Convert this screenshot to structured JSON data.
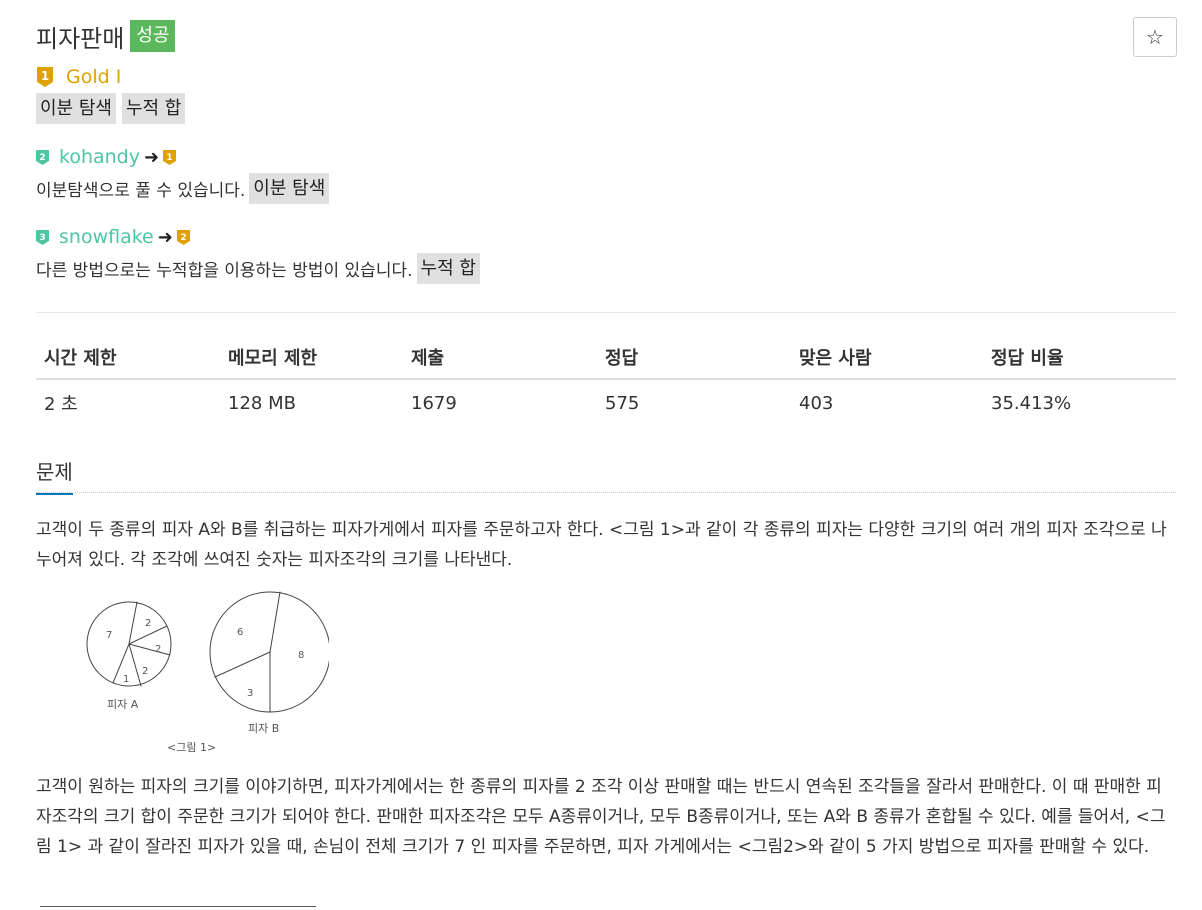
{
  "problem": {
    "title": "피자판매",
    "status": "성공",
    "star": "☆",
    "tier": {
      "label": "Gold I",
      "icon": "gold-tier-1-icon",
      "digit": "1",
      "color": "#e0a106"
    },
    "tags": [
      "이분 탐색",
      "누적 합"
    ]
  },
  "contributions": [
    {
      "user": "kohandy",
      "from_icon": "tier-2-icon",
      "from_digit": "2",
      "arrow": "➜",
      "to_icon": "tier-1-icon",
      "to_digit": "1",
      "text": "이분탐색으로 풀 수 있습니다.",
      "tag": "이분 탐색"
    },
    {
      "user": "snowflake",
      "from_icon": "tier-3-icon",
      "from_digit": "3",
      "arrow": "➜",
      "to_icon": "tier-2-icon",
      "to_digit": "2",
      "text": "다른 방법으로는 누적합을 이용하는 방법이 있습니다.",
      "tag": "누적 합"
    }
  ],
  "info_table": {
    "headers": [
      "시간 제한",
      "메모리 제한",
      "제출",
      "정답",
      "맞은 사람",
      "정답 비율"
    ],
    "values": [
      "2 초",
      "128 MB",
      "1679",
      "575",
      "403",
      "35.413%"
    ]
  },
  "section": {
    "title": "문제"
  },
  "paragraphs": {
    "p1": "고객이 두 종류의 피자 A와 B를 취급하는 피자가게에서 피자를 주문하고자 한다. <그림 1>과 같이 각 종류의 피자는 다양한 크기의 여러 개의 피자 조각으로 나누어져 있다. 각 조각에 쓰여진 숫자는 피자조각의 크기를 나타낸다.",
    "p2": "고객이 원하는 피자의 크기를 이야기하면, 피자가게에서는 한 종류의 피자를 2 조각 이상 판매할 때는 반드시 연속된 조각들을 잘라서 판매한다. 이 때 판매한 피자조각의 크기 합이 주문한 크기가 되어야 한다. 판매한 피자조각은 모두 A종류이거나, 모두 B종류이거나, 또는 A와 B 종류가 혼합될 수 있다. 예를 들어서, <그림 1> 과 같이 잘라진 피자가 있을 때, 손님이 전체 크기가 7 인 피자를 주문하면, 피자 가게에서는 <그림2>와 같이 5 가지 방법으로 피자를 판매할 수 있다."
  },
  "figure": {
    "pizza_a_label": "피자 A",
    "pizza_b_label": "피자 B",
    "caption": "<그림 1>",
    "a_slices": [
      "7",
      "2",
      "2",
      "2",
      "1"
    ],
    "b_slices": [
      "6",
      "8",
      "3"
    ]
  },
  "colors": {
    "success": "#5cb85c",
    "gold": "#e0a106",
    "contrib": "#4fc5a4",
    "link_underline": "#0076c0"
  }
}
